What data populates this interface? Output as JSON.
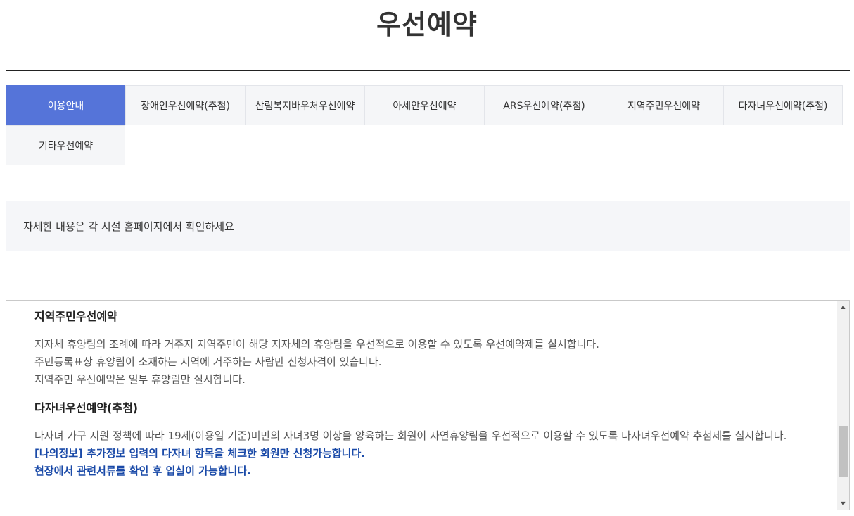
{
  "page": {
    "title": "우선예약"
  },
  "tabs": [
    {
      "label": "이용안내",
      "active": true
    },
    {
      "label": "장애인우선예약(추첨)",
      "active": false
    },
    {
      "label": "산림복지바우처우선예약",
      "active": false
    },
    {
      "label": "아세안우선예약",
      "active": false
    },
    {
      "label": "ARS우선예약(추첨)",
      "active": false
    },
    {
      "label": "지역주민우선예약",
      "active": false
    },
    {
      "label": "다자녀우선예약(추첨)",
      "active": false
    },
    {
      "label": "기타우선예약",
      "active": false
    }
  ],
  "notice": {
    "text": "자세한 내용은 각 시설 홈페이지에서 확인하세요"
  },
  "content": {
    "sections": [
      {
        "title": "지역주민우선예약",
        "lines": [
          "지자체 휴양림의 조례에 따라 거주지 지역주민이 해당 지자체의 휴양림을 우선적으로 이용할 수 있도록 우선예약제를 실시합니다.",
          "주민등록표상 휴양림이 소재하는 지역에 거주하는 사람만 신청자격이 있습니다.",
          "지역주민 우선예약은 일부 휴양림만 실시합니다."
        ]
      },
      {
        "title": "다자녀우선예약(추첨)",
        "lines": [
          "다자녀 가구 지원 정책에 따라 19세(이용일 기준)미만의 자녀3명 이상을 양육하는 회원이 자연휴양림을 우선적으로 이용할 수 있도록 다자녀우선예약 추첨제를 실시합니다.",
          "[나의정보] 추가정보 입력의 다자녀 항목을 체크한 회원만 신청가능합니다.",
          "현장에서 관련서류를 확인 후 입실이 가능합니다."
        ]
      }
    ],
    "scroll_position": 0.6
  },
  "colors": {
    "active_tab": "#5574d9",
    "highlight_text": "#1a4aa8"
  }
}
